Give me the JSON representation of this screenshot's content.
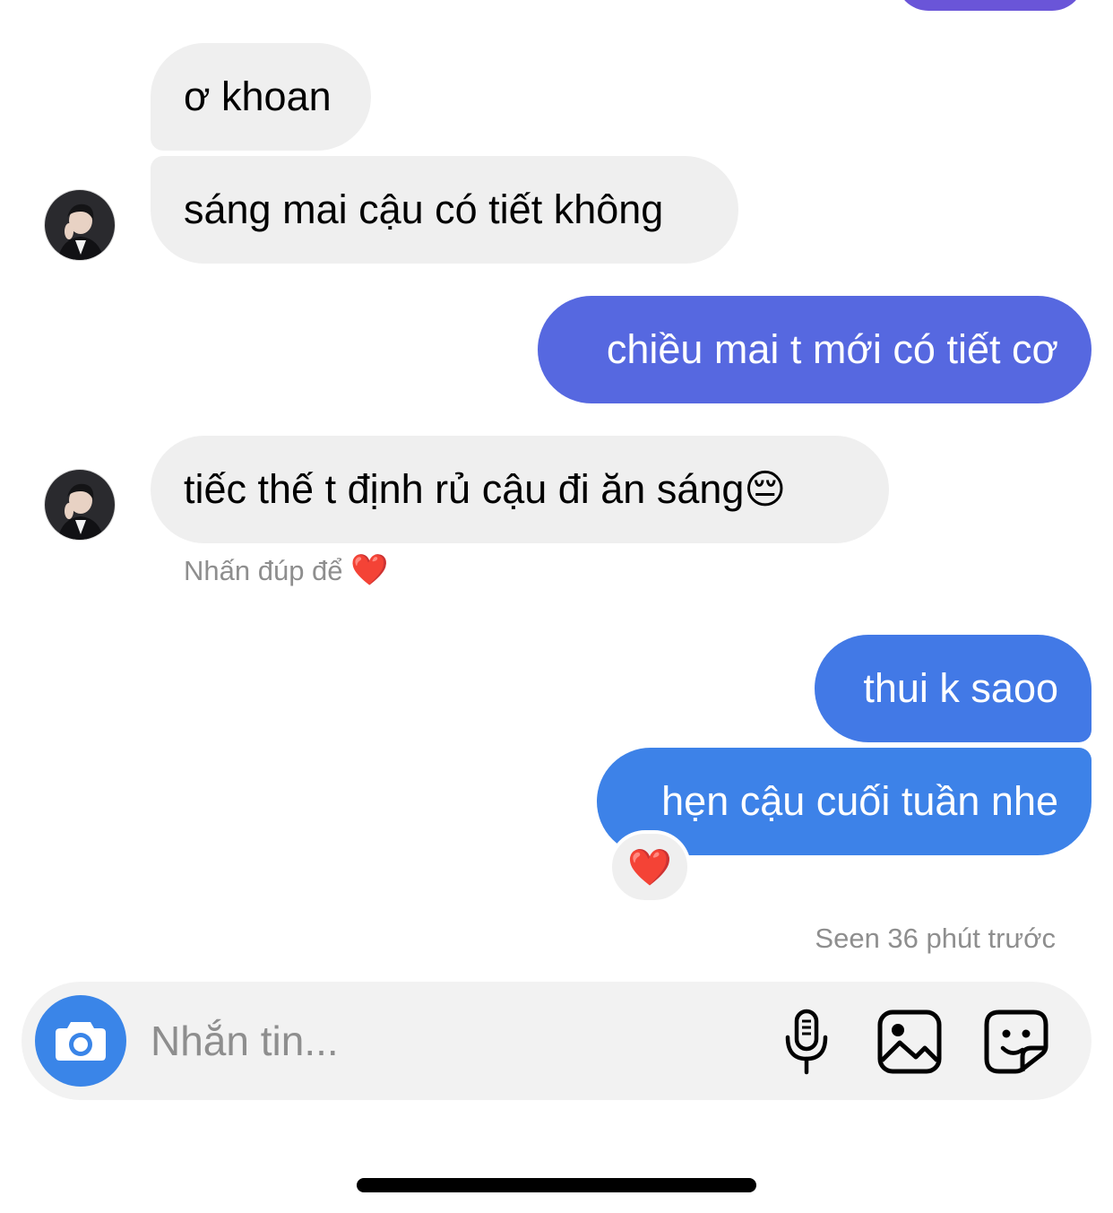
{
  "colors": {
    "outgoing_gradient_top": "#6a55d8",
    "outgoing_mid": "#5668e0",
    "outgoing_bottom": "#3d82e8",
    "incoming_bubble": "#efefef",
    "camera_button": "#3a85e8"
  },
  "messages": [
    {
      "direction": "incoming",
      "text": "ơ khoan"
    },
    {
      "direction": "incoming",
      "text": "sáng mai cậu có tiết không",
      "avatar": "contact-avatar"
    },
    {
      "direction": "outgoing",
      "text": "chiều mai t mới có tiết cơ"
    },
    {
      "direction": "incoming",
      "text": "tiếc thế t định rủ cậu đi ăn sáng😔",
      "avatar": "contact-avatar"
    },
    {
      "direction": "outgoing",
      "text": "thui k saoo"
    },
    {
      "direction": "outgoing",
      "text": "hẹn cậu cuối tuần nhe",
      "reaction": "❤️"
    }
  ],
  "hint": {
    "text": "Nhấn đúp để",
    "emoji": "❤️"
  },
  "seen_status": "Seen 36 phút trước",
  "composer": {
    "placeholder": "Nhắn tin...",
    "icons": [
      "camera-icon",
      "microphone-icon",
      "gallery-icon",
      "sticker-icon"
    ]
  }
}
